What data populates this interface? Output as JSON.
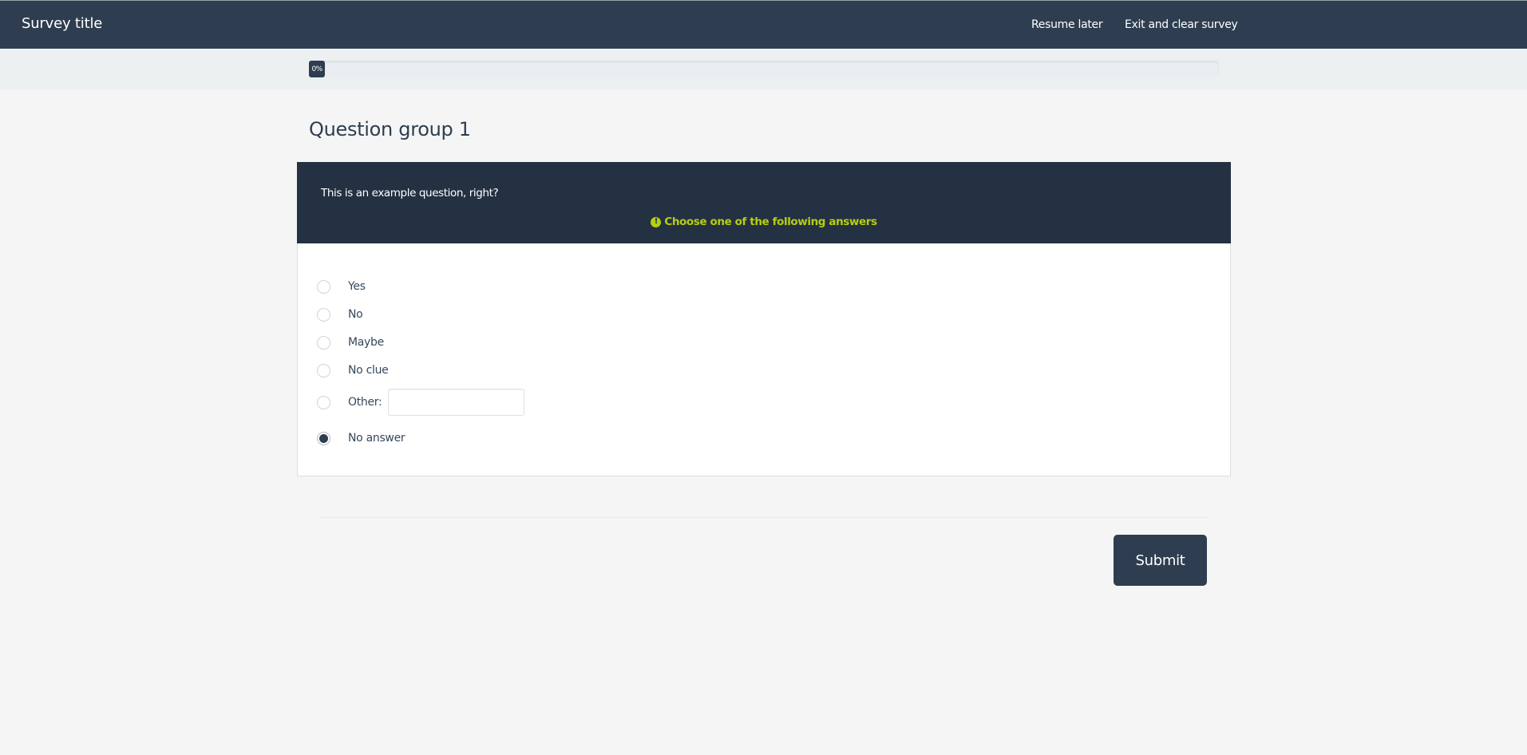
{
  "header": {
    "title": "Survey title",
    "links": {
      "resume_later": "Resume later",
      "exit_clear": "Exit and clear survey"
    }
  },
  "progress": {
    "value_percent": 0,
    "label": "0%"
  },
  "group": {
    "title": "Question group 1"
  },
  "question": {
    "text": "This is an example question, right?",
    "tip_icon": "exclamation-circle-icon",
    "tip": "Choose one of the following answers",
    "answers": [
      {
        "label": "Yes",
        "checked": false
      },
      {
        "label": "No",
        "checked": false
      },
      {
        "label": "Maybe",
        "checked": false
      },
      {
        "label": "No clue",
        "checked": false
      },
      {
        "label": "Other:",
        "checked": false,
        "has_input": true,
        "input_value": ""
      },
      {
        "label": "No answer",
        "checked": true
      }
    ]
  },
  "actions": {
    "submit_label": "Submit"
  },
  "colors": {
    "navbar": "#2e3e50",
    "question_header": "#243142",
    "tip": "#b6cf10",
    "background": "#f5f5f5"
  }
}
